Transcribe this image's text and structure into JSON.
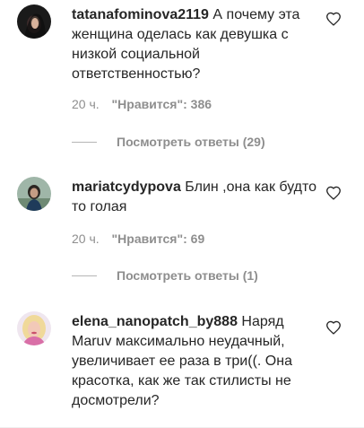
{
  "comments": [
    {
      "username": "tatanafominova2119",
      "text": "А почему эта женщина оделась как девушка с низкой социальной ответственностью?",
      "time": "20 ч.",
      "likes": "\"Нравится\": 386",
      "replies": "Посмотреть ответы (29)",
      "avatar_icon": "dark-haired-woman-avatar"
    },
    {
      "username": "mariatcydypova",
      "text": "Блин ,она как будто то голая",
      "time": "20 ч.",
      "likes": "\"Нравится\": 69",
      "replies": "Посмотреть ответы (1)",
      "avatar_icon": "woman-outdoors-avatar"
    },
    {
      "username": "elena_nanopatch_by888",
      "text": "Наряд Maruv максимально неудачный, увеличивает ее раза в три((. Она красотка, как же так стилисты не досмотрели?",
      "avatar_icon": "blonde-woman-avatar"
    }
  ],
  "colors": {
    "text": "#262626",
    "secondary": "#8e8e8e",
    "divider": "#efefef"
  }
}
